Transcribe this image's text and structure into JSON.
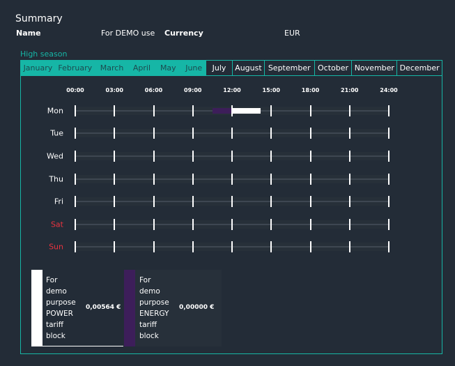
{
  "summary": {
    "title": "Summary",
    "name_label": "Name",
    "name_value": "For DEMO use",
    "currency_label": "Currency",
    "currency_value": "EUR"
  },
  "season": {
    "label": "High season",
    "months": [
      {
        "label": "January",
        "high": true
      },
      {
        "label": "February",
        "high": true
      },
      {
        "label": "March",
        "high": true
      },
      {
        "label": "April",
        "high": true
      },
      {
        "label": "May",
        "high": true
      },
      {
        "label": "June",
        "high": true
      },
      {
        "label": "July",
        "high": false
      },
      {
        "label": "August",
        "high": false
      },
      {
        "label": "September",
        "high": false
      },
      {
        "label": "October",
        "high": false
      },
      {
        "label": "November",
        "high": false
      },
      {
        "label": "December",
        "high": false
      }
    ]
  },
  "schedule": {
    "hours": [
      "00:00",
      "03:00",
      "06:00",
      "09:00",
      "12:00",
      "15:00",
      "18:00",
      "21:00",
      "24:00"
    ],
    "days": [
      {
        "label": "Mon",
        "weekend": false
      },
      {
        "label": "Tue",
        "weekend": false
      },
      {
        "label": "Wed",
        "weekend": false
      },
      {
        "label": "Thu",
        "weekend": false
      },
      {
        "label": "Fri",
        "weekend": false
      },
      {
        "label": "Sat",
        "weekend": true
      },
      {
        "label": "Sun",
        "weekend": true
      }
    ],
    "blocks": [
      {
        "day": "Mon",
        "start": 10.5,
        "end": 12.0,
        "tariff": "energy"
      },
      {
        "day": "Mon",
        "start": 12.0,
        "end": 14.2,
        "tariff": "power"
      }
    ]
  },
  "legend": {
    "power": {
      "lines": [
        "For",
        "demo",
        "purpose",
        "POWER",
        "tariff",
        "block"
      ],
      "value": "0,00564 €",
      "color": "#ffffff"
    },
    "energy": {
      "lines": [
        "For",
        "demo",
        "purpose",
        "ENERGY",
        "tariff",
        "block"
      ],
      "value": "0,00000 €",
      "color": "#3d1e5a"
    }
  },
  "colors": {
    "accent": "#16b6a6",
    "weekend": "#e8333f",
    "background": "#232c37"
  }
}
